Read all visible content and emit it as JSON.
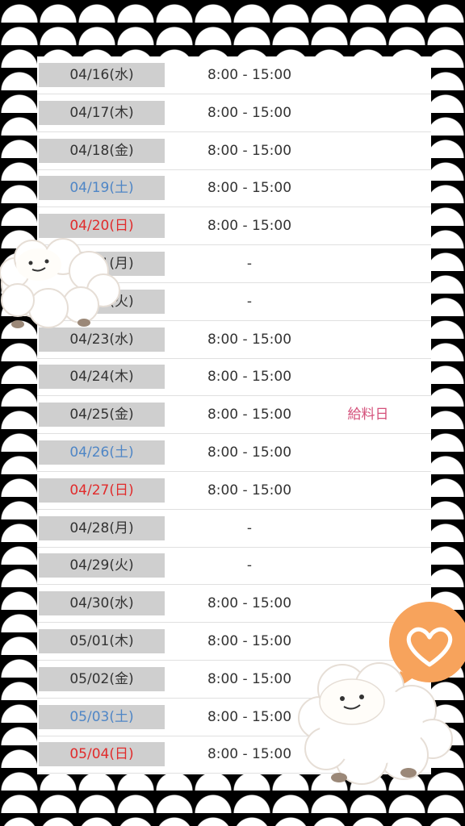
{
  "schedule": {
    "rows": [
      {
        "date": "04/16(水)",
        "day_type": "weekday",
        "time": "8:00 - 15:00",
        "note": ""
      },
      {
        "date": "04/17(木)",
        "day_type": "weekday",
        "time": "8:00 - 15:00",
        "note": ""
      },
      {
        "date": "04/18(金)",
        "day_type": "weekday",
        "time": "8:00 - 15:00",
        "note": ""
      },
      {
        "date": "04/19(土)",
        "day_type": "saturday",
        "time": "8:00 - 15:00",
        "note": ""
      },
      {
        "date": "04/20(日)",
        "day_type": "sunday",
        "time": "8:00 - 15:00",
        "note": ""
      },
      {
        "date": "04/21(月)",
        "day_type": "weekday",
        "time": "-",
        "note": ""
      },
      {
        "date": "04/22(火)",
        "day_type": "weekday",
        "time": "-",
        "note": ""
      },
      {
        "date": "04/23(水)",
        "day_type": "weekday",
        "time": "8:00 - 15:00",
        "note": ""
      },
      {
        "date": "04/24(木)",
        "day_type": "weekday",
        "time": "8:00 - 15:00",
        "note": ""
      },
      {
        "date": "04/25(金)",
        "day_type": "weekday",
        "time": "8:00 - 15:00",
        "note": "給料日"
      },
      {
        "date": "04/26(土)",
        "day_type": "saturday",
        "time": "8:00 - 15:00",
        "note": ""
      },
      {
        "date": "04/27(日)",
        "day_type": "sunday",
        "time": "8:00 - 15:00",
        "note": ""
      },
      {
        "date": "04/28(月)",
        "day_type": "weekday",
        "time": "-",
        "note": ""
      },
      {
        "date": "04/29(火)",
        "day_type": "weekday",
        "time": "-",
        "note": ""
      },
      {
        "date": "04/30(水)",
        "day_type": "weekday",
        "time": "8:00 - 15:00",
        "note": ""
      },
      {
        "date": "05/01(木)",
        "day_type": "weekday",
        "time": "8:00 - 15:00",
        "note": ""
      },
      {
        "date": "05/02(金)",
        "day_type": "weekday",
        "time": "8:00 - 15:00",
        "note": ""
      },
      {
        "date": "05/03(土)",
        "day_type": "saturday",
        "time": "8:00 - 15:00",
        "note": ""
      },
      {
        "date": "05/04(日)",
        "day_type": "sunday",
        "time": "8:00 - 15:00",
        "note": ""
      }
    ]
  },
  "decor": {
    "background_pattern": "black-white-scallop",
    "sheep_stickers": [
      "sheep-icon",
      "sheep-icon"
    ],
    "heart_bubble_icon": "heart-icon",
    "colors": {
      "saturday": "#4f86c6",
      "sunday": "#e12b2b",
      "payday_note": "#d4507a",
      "date_cell_bg": "#cfcfcf",
      "heart_bubble": "#f7a35c"
    }
  }
}
